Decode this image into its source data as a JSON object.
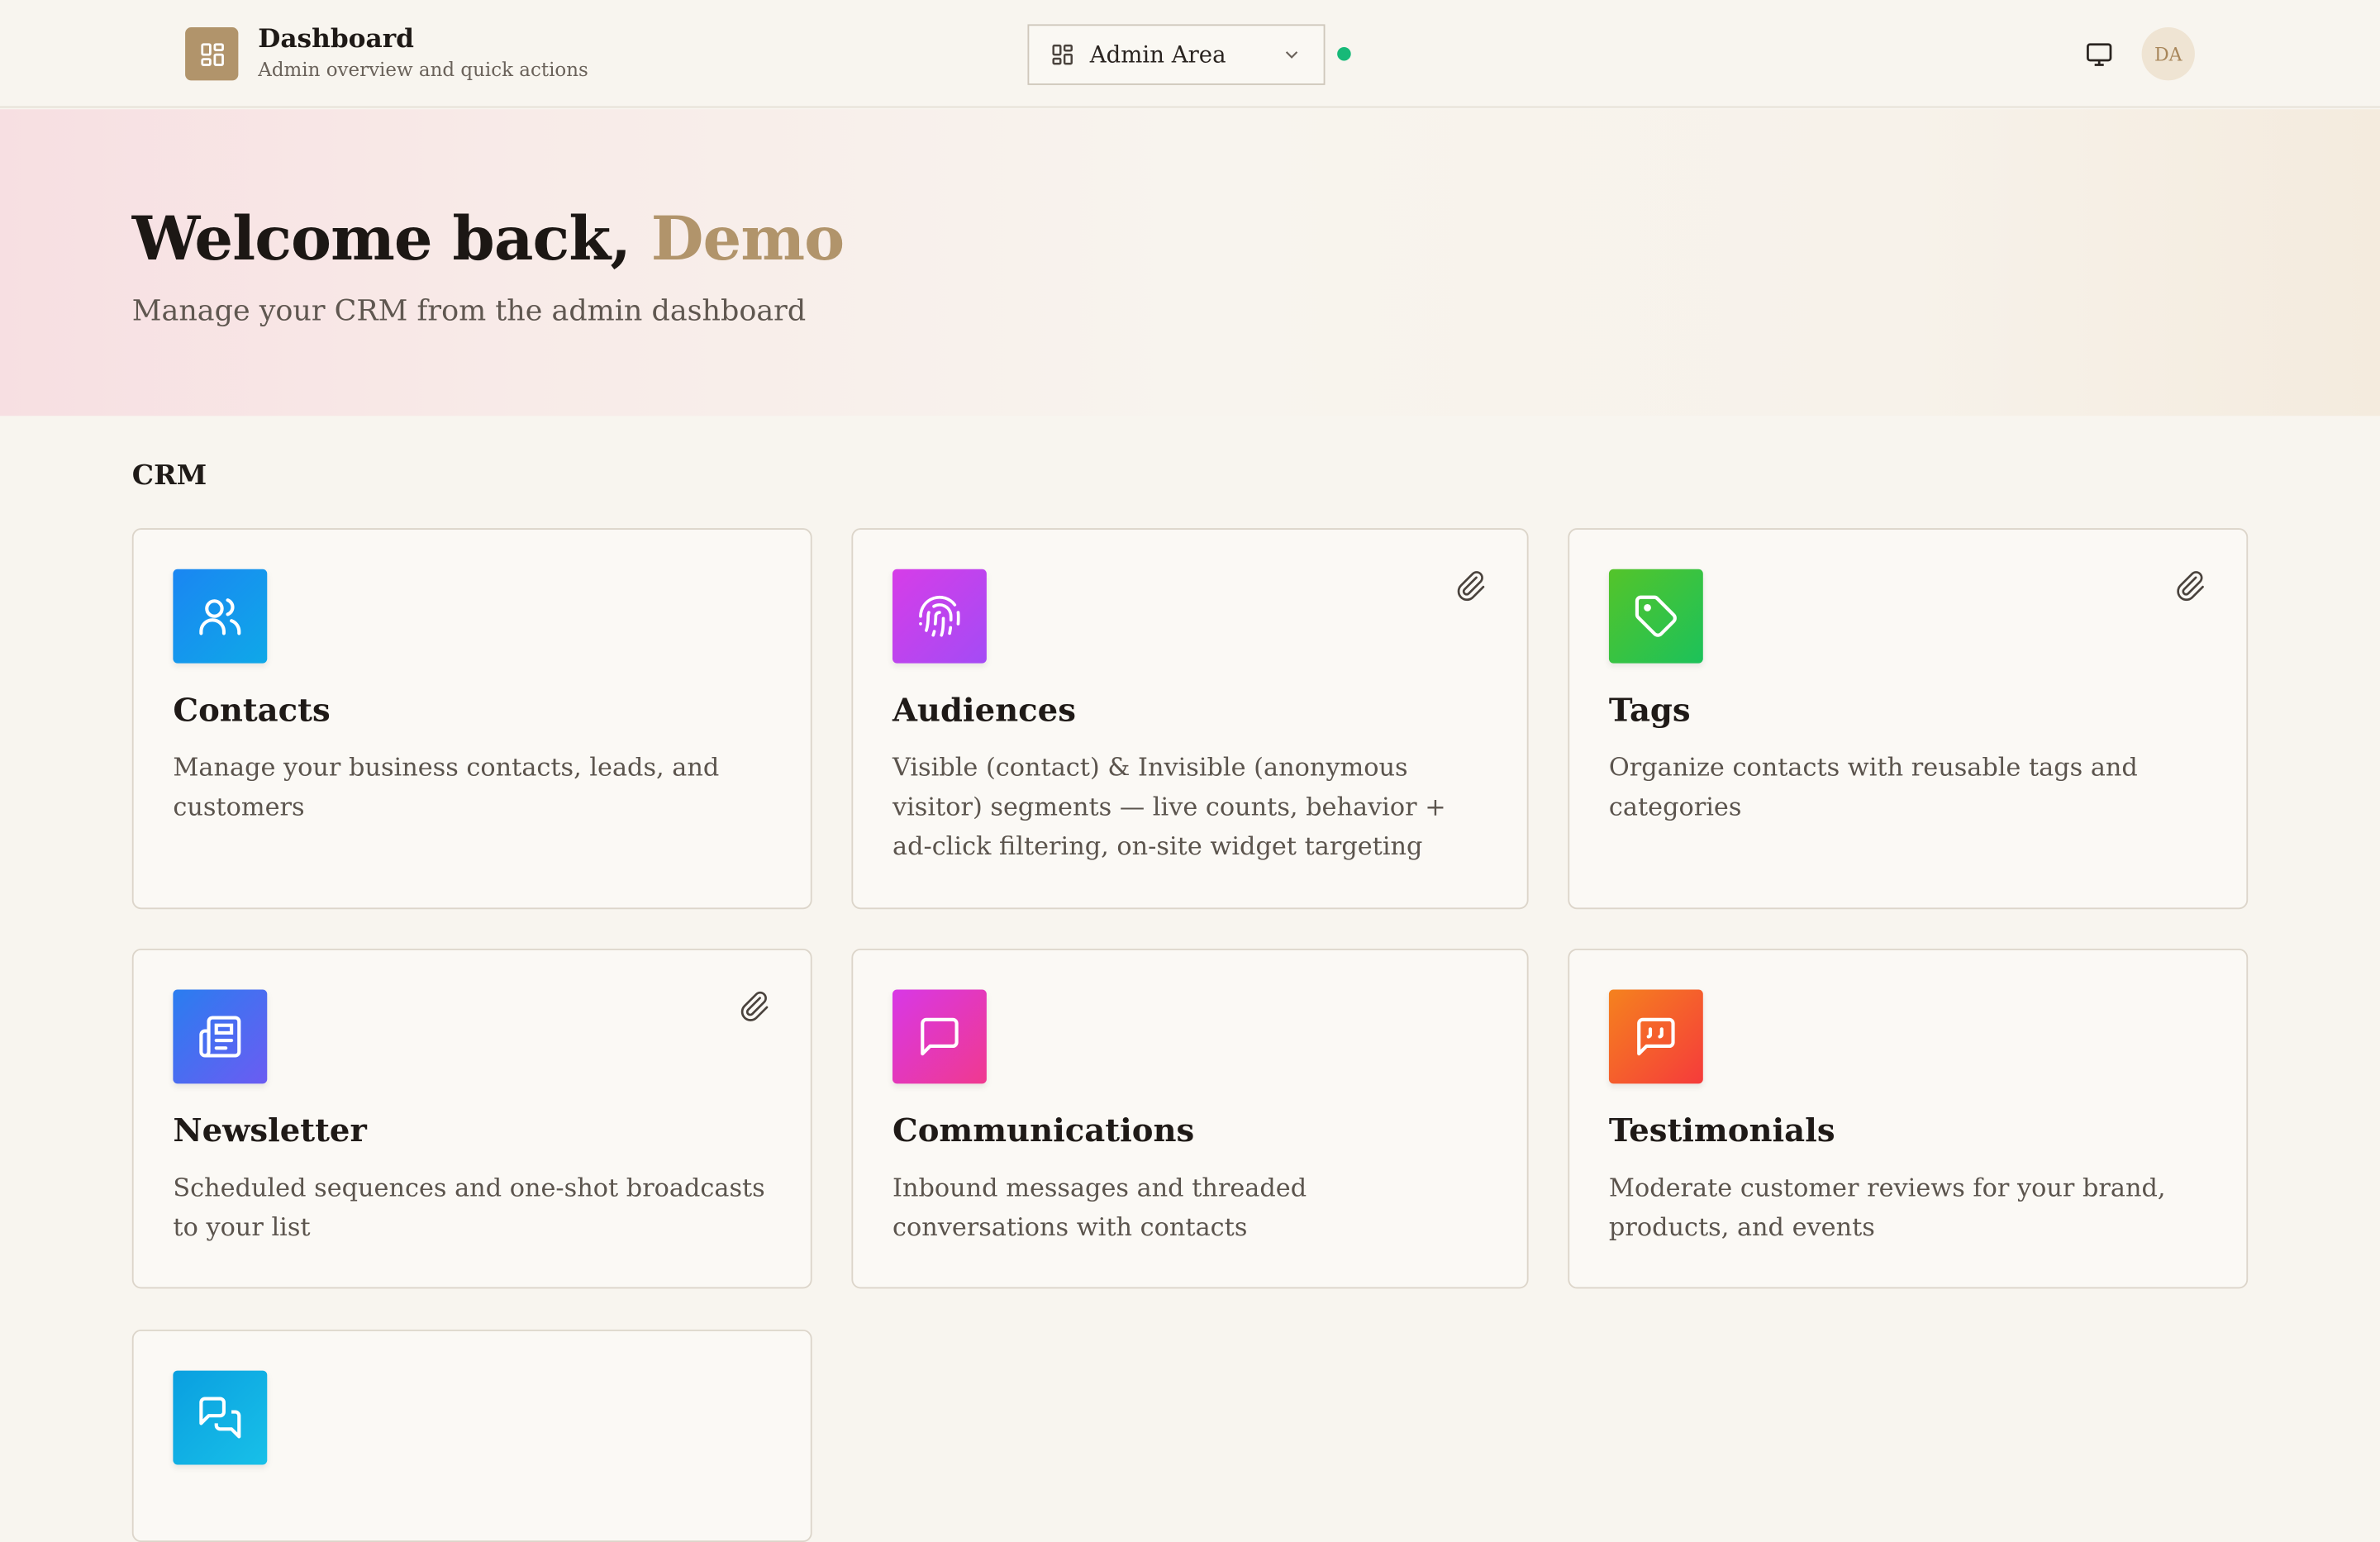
{
  "header": {
    "title": "Dashboard",
    "subtitle": "Admin overview and quick actions",
    "area_select": "Admin Area",
    "avatar_initials": "DA",
    "status_color": "#17b978"
  },
  "hero": {
    "greeting": "Welcome back,",
    "name": "Demo",
    "subtitle": "Manage your CRM from the admin dashboard"
  },
  "section": {
    "title": "CRM"
  },
  "cards": [
    {
      "title": "Contacts",
      "desc": "Manage your business contacts, leads, and customers",
      "icon": "users-icon",
      "pinned": false,
      "colors": [
        "#1a86f2",
        "#0fa8e8"
      ]
    },
    {
      "title": "Audiences",
      "desc": "Visible (contact) & Invisible (anonymous visitor) segments — live counts, behavior + ad-click filtering, on-site widget targeting",
      "icon": "fingerprint-icon",
      "pinned": true,
      "colors": [
        "#d63de8",
        "#a44bf5"
      ]
    },
    {
      "title": "Tags",
      "desc": "Organize contacts with reusable tags and categories",
      "icon": "tag-icon",
      "pinned": true,
      "colors": [
        "#54c42a",
        "#1cc25a"
      ]
    },
    {
      "title": "Newsletter",
      "desc": "Scheduled sequences and one-shot broadcasts to your list",
      "icon": "newspaper-icon",
      "pinned": true,
      "colors": [
        "#2a7df0",
        "#6b5cf2"
      ]
    },
    {
      "title": "Communications",
      "desc": "Inbound messages and threaded conversations with contacts",
      "icon": "message-square-icon",
      "pinned": false,
      "colors": [
        "#d838e6",
        "#f0398f"
      ]
    },
    {
      "title": "Testimonials",
      "desc": "Moderate customer reviews for your brand, products, and events",
      "icon": "quote-message-icon",
      "pinned": false,
      "colors": [
        "#f5821e",
        "#f53b3b"
      ]
    },
    {
      "title": "",
      "desc": "",
      "icon": "messages-icon",
      "pinned": false,
      "colors": [
        "#0a9fe0",
        "#18c0e8"
      ]
    }
  ]
}
